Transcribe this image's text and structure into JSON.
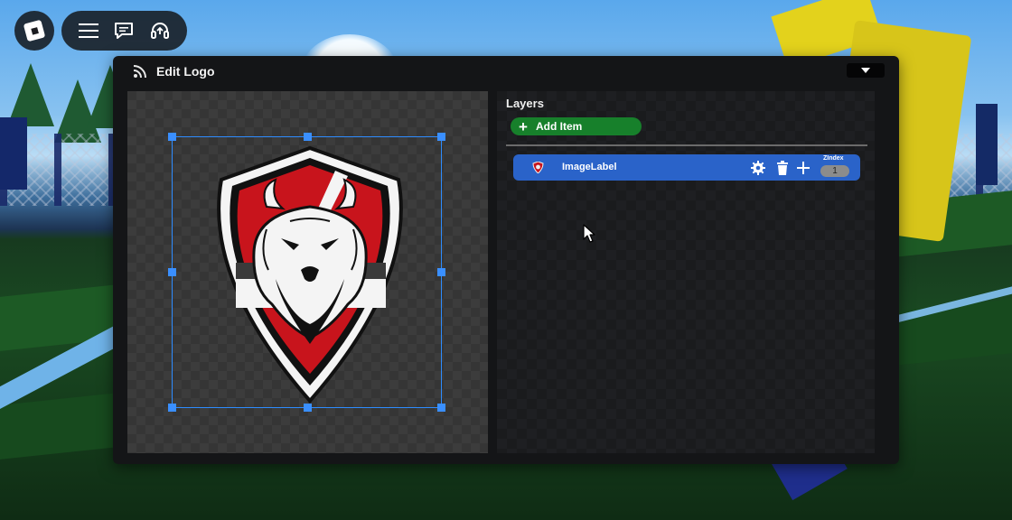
{
  "hud": {
    "icons": [
      "roblox-logo-icon",
      "menu-icon",
      "chat-icon",
      "headset-icon"
    ]
  },
  "window": {
    "title": "Edit Logo",
    "title_icon": "rss-feed-icon",
    "collapse_icon": "caret-down-icon"
  },
  "layers": {
    "heading": "Layers",
    "add_button_label": "Add Item",
    "items": [
      {
        "name": "ImageLabel",
        "zindex_label": "ZIndex",
        "zindex_value": "1"
      }
    ]
  },
  "colors": {
    "accent": "#2a63c9",
    "add_button": "#17802b",
    "selection": "#2d8cff",
    "window_bg": "#141517"
  }
}
